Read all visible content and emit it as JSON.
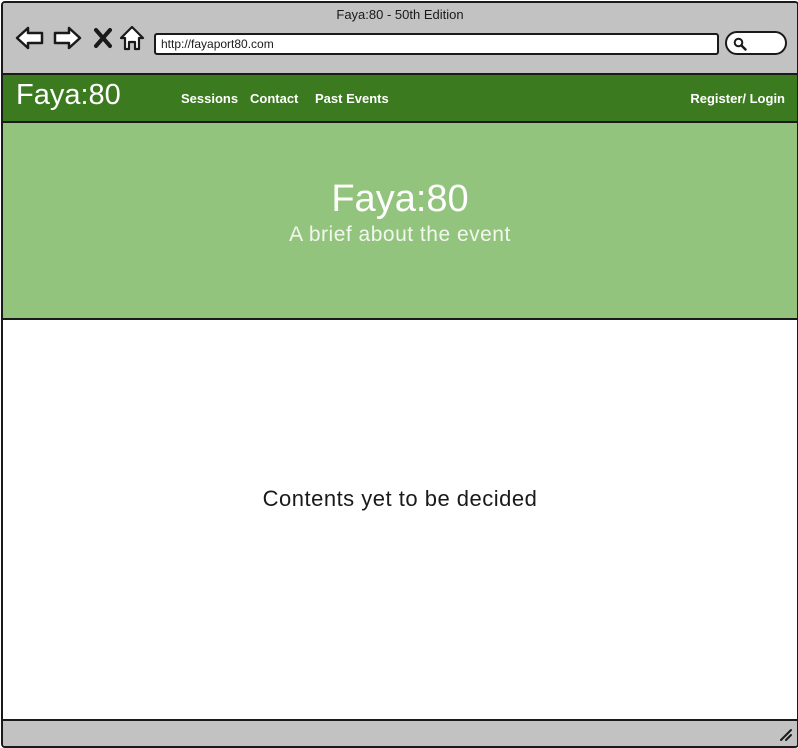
{
  "window": {
    "title": "Faya:80 - 50th Edition"
  },
  "browser": {
    "url": "http://fayaport80.com",
    "icons": [
      "back-arrow-icon",
      "forward-arrow-icon",
      "close-x-icon",
      "home-icon",
      "search-icon",
      "resize-grip-icon"
    ]
  },
  "navbar": {
    "brand": "Faya:80",
    "links": [
      "Sessions",
      "Contact",
      "Past Events"
    ],
    "auth": "Register/ Login"
  },
  "hero": {
    "title": "Faya:80",
    "subtitle": "A brief about the event"
  },
  "main": {
    "placeholder_text": "Contents yet to be decided"
  },
  "colors": {
    "chrome": "#c2c2c2",
    "navbar": "#3b7a1f",
    "hero": "#93c47d",
    "text_light": "#ffffff",
    "outline": "#1a1a1a"
  }
}
